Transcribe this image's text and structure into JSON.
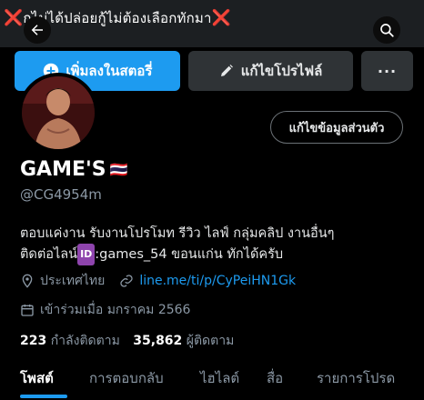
{
  "header": {
    "title": "กูไม่ได้ปล่อยกู้ไม่ต้องเลือกทักมา",
    "left_mark": "❌",
    "right_mark": "❌",
    "back_icon": "arrow-left-icon",
    "search_icon": "search-icon"
  },
  "actions": {
    "add_story": "เพิ่มลงในสตอรี่",
    "edit_profile": "แก้ไขโปรไฟล์",
    "more": "···"
  },
  "profile": {
    "edit_personal_info": "แก้ไขข้อมูลส่วนตัว",
    "name": "GAME'S",
    "flag": "🇹🇭",
    "handle": "@CG4954m",
    "bio_line1": "ตอบแค่งาน รับงานโปรโมท รีวิว ไลฟ์ กลุ่มคลิป งานอื่นๆ",
    "bio_line2_prefix": "ติดต่อไลน์",
    "bio_badge": "ID",
    "bio_line2_suffix": ":games_54 ขอนแก่น ทักได้ครับ",
    "location": "ประเทศไทย",
    "link": "line.me/ti/p/CyPeiHN1Gk",
    "joined": "เข้าร่วมเมื่อ มกราคม 2566",
    "following_count": "223",
    "following_label": "กำลังติดตาม",
    "followers_count": "35,862",
    "followers_label": "ผู้ติดตาม"
  },
  "tabs": [
    {
      "label": "โพสต์"
    },
    {
      "label": "การตอบกลับ"
    },
    {
      "label": "ไฮไลต์"
    },
    {
      "label": "สื่อ"
    },
    {
      "label": "รายการโปรด"
    }
  ],
  "colors": {
    "accent": "#1d9bf0",
    "background": "#000000",
    "muted": "#8b98a5"
  }
}
